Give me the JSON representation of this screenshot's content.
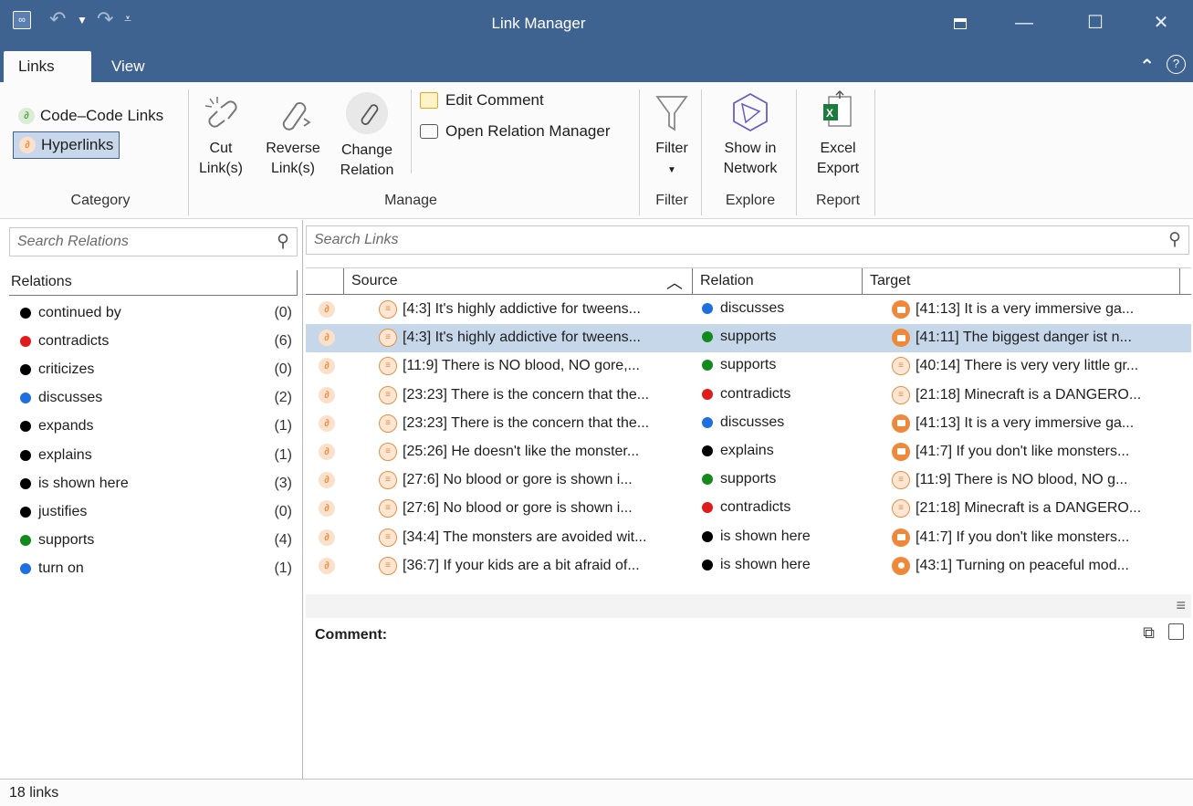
{
  "window": {
    "title": "Link Manager"
  },
  "tabs": [
    {
      "label": "Links",
      "active": true
    },
    {
      "label": "View",
      "active": false
    }
  ],
  "ribbon": {
    "category": {
      "group_label": "Category",
      "items": [
        {
          "label": "Code–Code Links",
          "icon": "link-green-icon",
          "selected": false
        },
        {
          "label": "Hyperlinks",
          "icon": "link-orange-icon",
          "selected": true
        }
      ]
    },
    "manage": {
      "group_label": "Manage",
      "cut": {
        "line1": "Cut",
        "line2": "Link(s)"
      },
      "reverse": {
        "line1": "Reverse",
        "line2": "Link(s)"
      },
      "change": {
        "line1": "Change",
        "line2": "Relation"
      },
      "edit_comment": "Edit Comment",
      "open_relation_manager": "Open Relation Manager"
    },
    "filter": {
      "group_label": "Filter",
      "button": "Filter"
    },
    "explore": {
      "group_label": "Explore",
      "line1": "Show in",
      "line2": "Network"
    },
    "report": {
      "group_label": "Report",
      "line1": "Excel",
      "line2": "Export"
    }
  },
  "relations_pane": {
    "search_placeholder": "Search Relations",
    "header": "Relations",
    "items": [
      {
        "label": "continued by",
        "count": "(0)",
        "color": "#000000"
      },
      {
        "label": "contradicts",
        "count": "(6)",
        "color": "#e01b1b"
      },
      {
        "label": "criticizes",
        "count": "(0)",
        "color": "#000000"
      },
      {
        "label": "discusses",
        "count": "(2)",
        "color": "#1e6fe0"
      },
      {
        "label": "expands",
        "count": "(1)",
        "color": "#000000"
      },
      {
        "label": "explains",
        "count": "(1)",
        "color": "#000000"
      },
      {
        "label": "is shown here",
        "count": "(3)",
        "color": "#000000"
      },
      {
        "label": "justifies",
        "count": "(0)",
        "color": "#000000"
      },
      {
        "label": "supports",
        "count": "(4)",
        "color": "#138a1c"
      },
      {
        "label": "turn on",
        "count": "(1)",
        "color": "#1e6fe0"
      }
    ]
  },
  "links_pane": {
    "search_placeholder": "Search Links",
    "columns": {
      "source": "Source",
      "relation": "Relation",
      "target": "Target"
    },
    "rows": [
      {
        "source": "[4:3] It's highly addictive for tweens...",
        "relation": "discusses",
        "relation_color": "#1e6fe0",
        "target": "[41:13] It is a very immersive ga...",
        "target_icon": "video",
        "selected": false
      },
      {
        "source": "[4:3] It's highly addictive for tweens...",
        "relation": "supports",
        "relation_color": "#138a1c",
        "target": "[41:11] The biggest danger ist n...",
        "target_icon": "video",
        "selected": true
      },
      {
        "source": "[11:9] There is NO blood, NO gore,...",
        "relation": "supports",
        "relation_color": "#138a1c",
        "target": "[40:14] There is very very little gr...",
        "target_icon": "quote",
        "selected": false
      },
      {
        "source": "[23:23] There is the concern that the...",
        "relation": "contradicts",
        "relation_color": "#e01b1b",
        "target": "[21:18] Minecraft is a DANGERO...",
        "target_icon": "quote",
        "selected": false
      },
      {
        "source": "[23:23] There is the concern that the...",
        "relation": "discusses",
        "relation_color": "#1e6fe0",
        "target": "[41:13] It is a very immersive ga...",
        "target_icon": "video",
        "selected": false
      },
      {
        "source": "[25:26] He doesn't like the monster...",
        "relation": "explains",
        "relation_color": "#000000",
        "target": "[41:7] If you don't like monsters...",
        "target_icon": "video",
        "selected": false
      },
      {
        "source": "[27:6] No blood or gore is shown i...",
        "relation": "supports",
        "relation_color": "#138a1c",
        "target": "[11:9] There is NO blood, NO g...",
        "target_icon": "quote",
        "selected": false
      },
      {
        "source": "[27:6] No blood or gore is shown i...",
        "relation": "contradicts",
        "relation_color": "#e01b1b",
        "target": "[21:18] Minecraft is a DANGERO...",
        "target_icon": "quote",
        "selected": false
      },
      {
        "source": "[34:4] The monsters are avoided wit...",
        "relation": "is shown here",
        "relation_color": "#000000",
        "target": "[41:7] If you don't like monsters...",
        "target_icon": "video",
        "selected": false
      },
      {
        "source": "[36:7] If your kids are a bit afraid of...",
        "relation": "is shown here",
        "relation_color": "#000000",
        "target": "[43:1] Turning on peaceful mod...",
        "target_icon": "picture",
        "selected": false
      }
    ],
    "comment_label": "Comment:"
  },
  "status": {
    "text": "18 links"
  }
}
